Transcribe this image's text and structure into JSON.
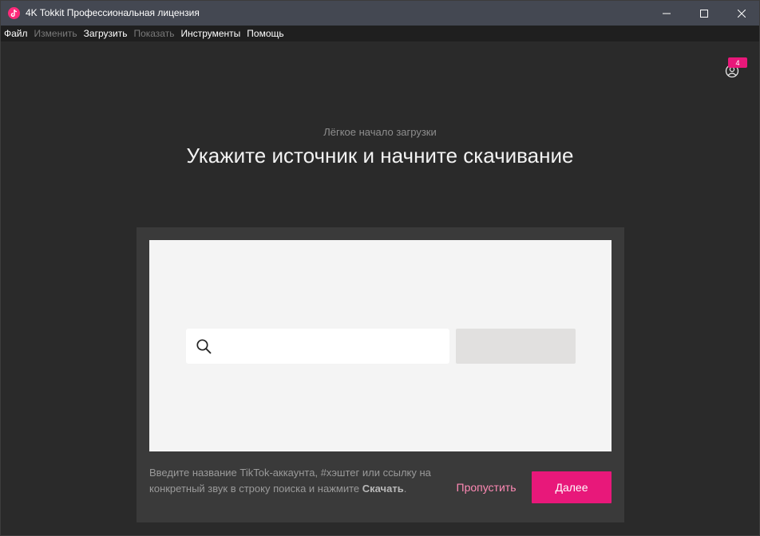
{
  "window": {
    "title": "4K Tokkit Профессиональная лицензия"
  },
  "menu": [
    {
      "label": "Файл",
      "enabled": true
    },
    {
      "label": "Изменить",
      "enabled": false
    },
    {
      "label": "Загрузить",
      "enabled": true
    },
    {
      "label": "Показать",
      "enabled": false
    },
    {
      "label": "Инструменты",
      "enabled": true
    },
    {
      "label": "Помощь",
      "enabled": true
    }
  ],
  "account": {
    "badge_count": "4"
  },
  "onboarding": {
    "subtitle": "Лёгкое начало загрузки",
    "heading": "Укажите источник и начните скачивание",
    "search": {
      "value": "",
      "placeholder": ""
    },
    "download_button_label": "",
    "hint_part1": "Введите название TikTok-аккаунта, #хэштег или ссылку на конкретный звук в строку поиска и нажмите ",
    "hint_bold": "Скачать",
    "hint_part2": ".",
    "skip_label": "Пропустить",
    "next_label": "Далее"
  },
  "colors": {
    "accent": "#e8187a",
    "skip_text": "#ff8ab5",
    "titlebar": "#444852",
    "background": "#2a2a2a"
  }
}
